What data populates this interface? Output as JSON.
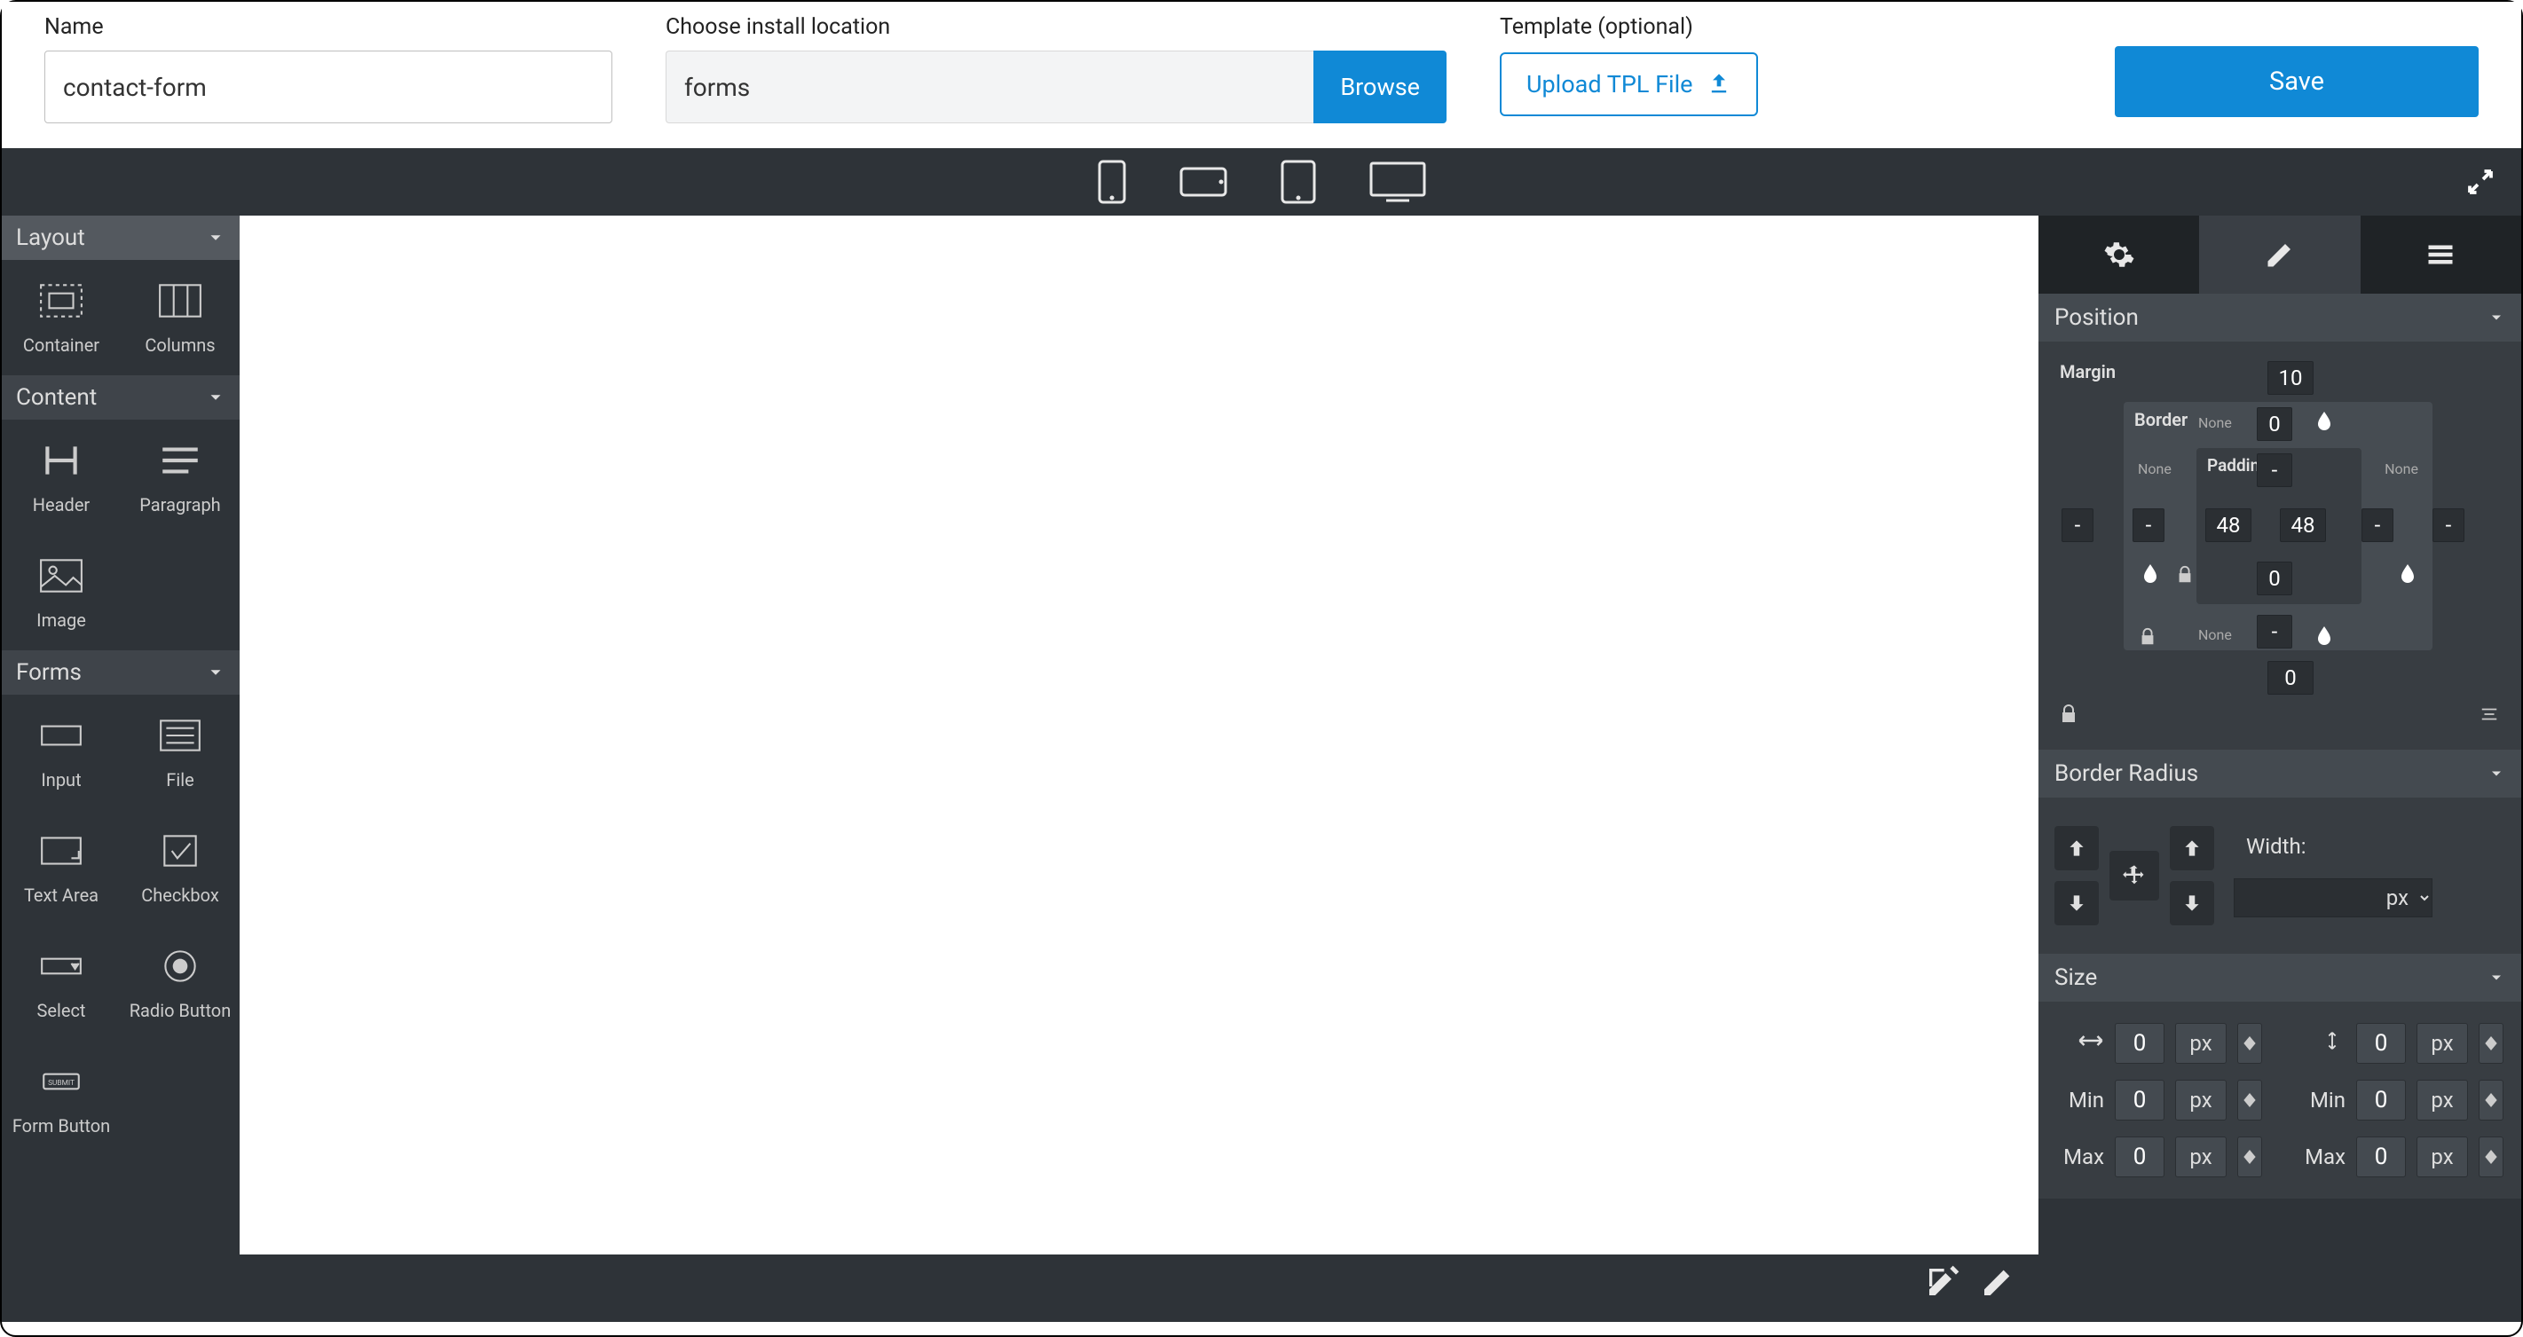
{
  "top": {
    "name_label": "Name",
    "name_value": "contact-form",
    "location_label": "Choose install location",
    "location_value": "forms",
    "browse_label": "Browse",
    "template_label": "Template (optional)",
    "upload_label": "Upload TPL File",
    "save_label": "Save"
  },
  "devices": [
    "phone-portrait",
    "phone-landscape",
    "tablet",
    "desktop"
  ],
  "left": {
    "sections": [
      {
        "title": "Layout",
        "widgets": [
          {
            "label": "Container",
            "icon": "container-icon"
          },
          {
            "label": "Columns",
            "icon": "columns-icon"
          }
        ]
      },
      {
        "title": "Content",
        "widgets": [
          {
            "label": "Header",
            "icon": "header-icon"
          },
          {
            "label": "Paragraph",
            "icon": "paragraph-icon"
          },
          {
            "label": "Image",
            "icon": "image-icon"
          }
        ]
      },
      {
        "title": "Forms",
        "widgets": [
          {
            "label": "Input",
            "icon": "input-icon"
          },
          {
            "label": "File",
            "icon": "file-icon"
          },
          {
            "label": "Text Area",
            "icon": "textarea-icon"
          },
          {
            "label": "Checkbox",
            "icon": "checkbox-icon"
          },
          {
            "label": "Select",
            "icon": "select-icon"
          },
          {
            "label": "Radio Button",
            "icon": "radio-icon"
          },
          {
            "label": "Form Button",
            "icon": "submit-icon"
          }
        ]
      }
    ]
  },
  "right": {
    "tabs": [
      "settings",
      "edit",
      "list"
    ],
    "active_tab": "edit",
    "panels": {
      "position": {
        "title": "Position",
        "margin_label": "Margin",
        "border_label": "Border",
        "padding_label": "Padding",
        "none_label": "None",
        "margin": {
          "top": "10",
          "right": "-",
          "bottom": "0",
          "left": "-"
        },
        "border": {
          "top": "0",
          "right": "-",
          "bottom": "-",
          "left": "-"
        },
        "padding": {
          "top": "-",
          "right": "48",
          "bottom": "0",
          "left": "48"
        }
      },
      "border_radius": {
        "title": "Border Radius",
        "width_label": "Width:",
        "width_unit": "px"
      },
      "size": {
        "title": "Size",
        "width": {
          "value": "0",
          "unit": "px"
        },
        "height": {
          "value": "0",
          "unit": "px"
        },
        "min_w": {
          "label": "Min",
          "value": "0",
          "unit": "px"
        },
        "min_h": {
          "label": "Min",
          "value": "0",
          "unit": "px"
        },
        "max_w": {
          "label": "Max",
          "value": "0",
          "unit": "px"
        },
        "max_h": {
          "label": "Max",
          "value": "0",
          "unit": "px"
        }
      }
    }
  }
}
